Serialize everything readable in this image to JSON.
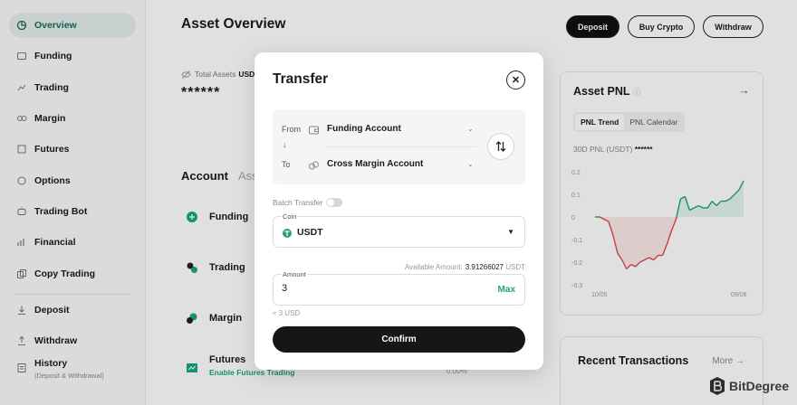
{
  "sidebar": {
    "items": [
      {
        "label": "Overview"
      },
      {
        "label": "Funding"
      },
      {
        "label": "Trading"
      },
      {
        "label": "Margin"
      },
      {
        "label": "Futures"
      },
      {
        "label": "Options"
      },
      {
        "label": "Trading Bot"
      },
      {
        "label": "Financial"
      },
      {
        "label": "Copy Trading"
      },
      {
        "label": "Deposit"
      },
      {
        "label": "Withdraw"
      }
    ],
    "history": {
      "label": "History",
      "sublabel": "(Deposit & Withdrawal)"
    }
  },
  "header": {
    "title": "Asset Overview",
    "deposit_label": "Deposit",
    "buy_crypto_label": "Buy Crypto",
    "withdraw_label": "Withdraw"
  },
  "assets": {
    "total_label": "Total Assets",
    "currency": "USD",
    "hidden_value": "******"
  },
  "accounts": {
    "tab_active": "Account",
    "tab_inactive": "Asse",
    "rows": [
      {
        "label": "Funding"
      },
      {
        "label": "Trading"
      },
      {
        "label": "Margin"
      },
      {
        "label": "Futures",
        "sub": "Enable Futures Trading"
      }
    ],
    "partial_pct": "0.00%"
  },
  "pnl": {
    "title": "Asset PNL",
    "tabs": [
      "PNL Trend",
      "PNL Calendar"
    ],
    "summary_label": "30D PNL (USDT)",
    "summary_value": "******"
  },
  "chart_data": {
    "type": "line",
    "x_start_label": "10/05",
    "x_end_label": "09/06",
    "y_ticks": [
      "0.2",
      "0.1",
      "0",
      "-0.1",
      "-0.2",
      "-0.3"
    ],
    "ylim": [
      -0.3,
      0.2
    ],
    "x": [
      0,
      1,
      2,
      3,
      4,
      5,
      6,
      7,
      8,
      9,
      10,
      11,
      12,
      13,
      14,
      15,
      16,
      17,
      18,
      19,
      20,
      21,
      22,
      23,
      24,
      25,
      26,
      27,
      28,
      29,
      30,
      31,
      32,
      33
    ],
    "values": [
      0.0,
      0.0,
      -0.01,
      -0.02,
      -0.08,
      -0.16,
      -0.19,
      -0.23,
      -0.21,
      -0.22,
      -0.2,
      -0.19,
      -0.18,
      -0.19,
      -0.17,
      -0.17,
      -0.12,
      -0.06,
      -0.01,
      0.08,
      0.09,
      0.03,
      0.04,
      0.05,
      0.04,
      0.04,
      0.07,
      0.05,
      0.07,
      0.07,
      0.08,
      0.1,
      0.12,
      0.16
    ],
    "colors": {
      "negative": "#e04848",
      "positive": "#1aa47f"
    }
  },
  "recent": {
    "title": "Recent Transactions",
    "more_label": "More →"
  },
  "watermark": {
    "brand": "BitDegree"
  },
  "modal": {
    "title": "Transfer",
    "from_label": "From",
    "from_value": "Funding Account",
    "to_label": "To",
    "to_value": "Cross Margin Account",
    "batch_label": "Batch Transfer",
    "coin_label": "Coin",
    "coin_value": "USDT",
    "available_label": "Available Amount:",
    "available_value": "3.91266027",
    "available_unit": "USDT",
    "amount_label": "Amount",
    "amount_value": "3",
    "max_label": "Max",
    "approx_text": "≈ 3 USD",
    "confirm_label": "Confirm"
  }
}
